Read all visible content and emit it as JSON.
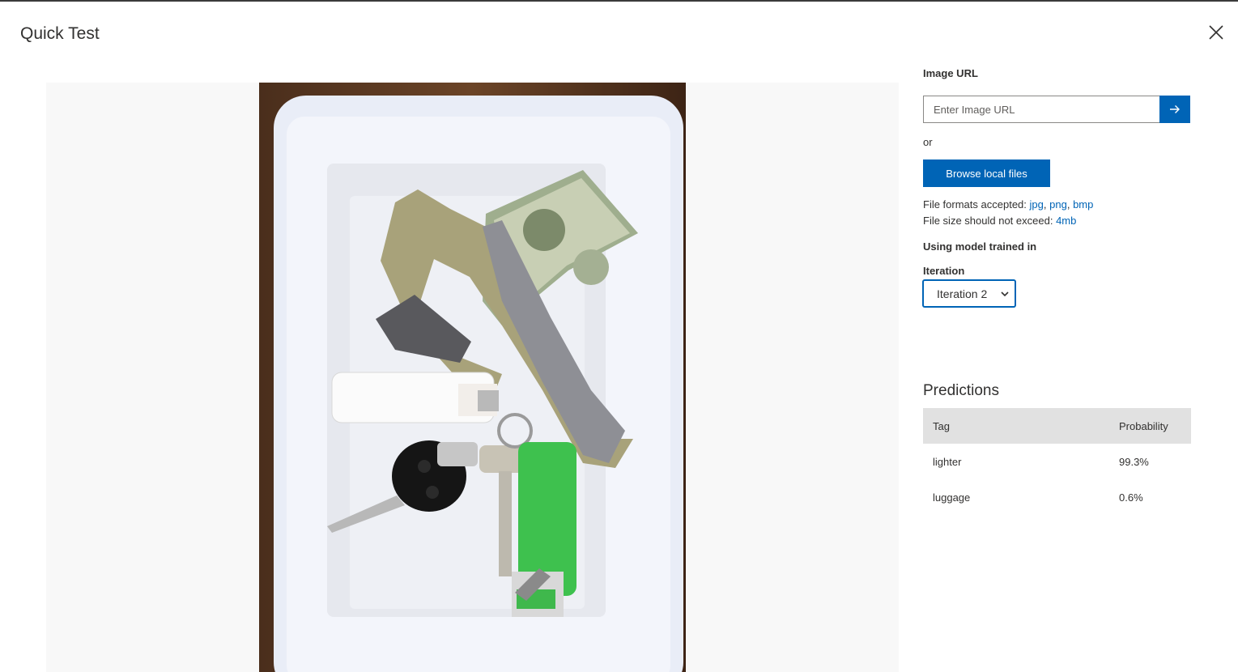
{
  "dialog": {
    "title": "Quick Test"
  },
  "image_url": {
    "label": "Image URL",
    "placeholder": "Enter Image URL",
    "value": ""
  },
  "or_text": "or",
  "browse_button": "Browse local files",
  "file_formats": {
    "label": "File formats accepted:",
    "formats": [
      "jpg",
      "png",
      "bmp"
    ]
  },
  "file_size": {
    "label": "File size should not exceed:",
    "value": "4mb"
  },
  "model": {
    "heading": "Using model trained in",
    "iteration_label": "Iteration",
    "selected": "Iteration 2"
  },
  "predictions": {
    "title": "Predictions",
    "columns": [
      "Tag",
      "Probability"
    ],
    "rows": [
      {
        "tag": "lighter",
        "probability": "99.3%"
      },
      {
        "tag": "luggage",
        "probability": "0.6%"
      }
    ]
  },
  "colors": {
    "accent": "#0064b6",
    "table_header": "#e1e1e1",
    "preview_bg": "#f8f8f8"
  },
  "icons": {
    "close": "close-icon",
    "submit": "arrow-right-icon",
    "dropdown": "chevron-down-icon"
  }
}
